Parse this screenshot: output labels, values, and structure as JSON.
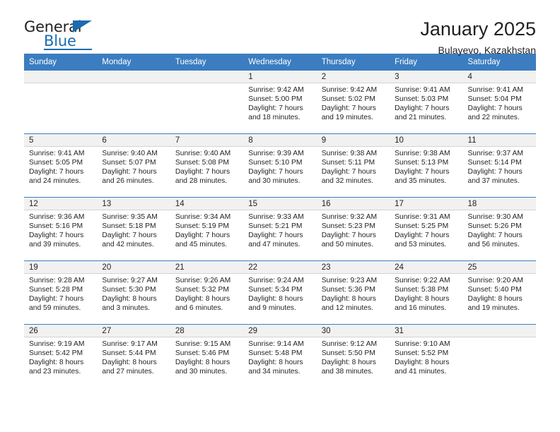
{
  "brand": {
    "name_top": "General",
    "name_bottom": "Blue",
    "accent_color": "#1b6bb0"
  },
  "header": {
    "title": "January 2025",
    "subtitle": "Bulayevo, Kazakhstan"
  },
  "calendar": {
    "header_color": "#3b7dc0",
    "weekday_headers": [
      "Sunday",
      "Monday",
      "Tuesday",
      "Wednesday",
      "Thursday",
      "Friday",
      "Saturday"
    ],
    "weeks": [
      [
        {
          "day": "",
          "sunrise": "",
          "sunset": "",
          "daylight_line1": "",
          "daylight_line2": "",
          "empty": true
        },
        {
          "day": "",
          "sunrise": "",
          "sunset": "",
          "daylight_line1": "",
          "daylight_line2": "",
          "empty": true
        },
        {
          "day": "",
          "sunrise": "",
          "sunset": "",
          "daylight_line1": "",
          "daylight_line2": "",
          "empty": true
        },
        {
          "day": "1",
          "sunrise": "Sunrise: 9:42 AM",
          "sunset": "Sunset: 5:00 PM",
          "daylight_line1": "Daylight: 7 hours",
          "daylight_line2": "and 18 minutes."
        },
        {
          "day": "2",
          "sunrise": "Sunrise: 9:42 AM",
          "sunset": "Sunset: 5:02 PM",
          "daylight_line1": "Daylight: 7 hours",
          "daylight_line2": "and 19 minutes."
        },
        {
          "day": "3",
          "sunrise": "Sunrise: 9:41 AM",
          "sunset": "Sunset: 5:03 PM",
          "daylight_line1": "Daylight: 7 hours",
          "daylight_line2": "and 21 minutes."
        },
        {
          "day": "4",
          "sunrise": "Sunrise: 9:41 AM",
          "sunset": "Sunset: 5:04 PM",
          "daylight_line1": "Daylight: 7 hours",
          "daylight_line2": "and 22 minutes."
        }
      ],
      [
        {
          "day": "5",
          "sunrise": "Sunrise: 9:41 AM",
          "sunset": "Sunset: 5:05 PM",
          "daylight_line1": "Daylight: 7 hours",
          "daylight_line2": "and 24 minutes."
        },
        {
          "day": "6",
          "sunrise": "Sunrise: 9:40 AM",
          "sunset": "Sunset: 5:07 PM",
          "daylight_line1": "Daylight: 7 hours",
          "daylight_line2": "and 26 minutes."
        },
        {
          "day": "7",
          "sunrise": "Sunrise: 9:40 AM",
          "sunset": "Sunset: 5:08 PM",
          "daylight_line1": "Daylight: 7 hours",
          "daylight_line2": "and 28 minutes."
        },
        {
          "day": "8",
          "sunrise": "Sunrise: 9:39 AM",
          "sunset": "Sunset: 5:10 PM",
          "daylight_line1": "Daylight: 7 hours",
          "daylight_line2": "and 30 minutes."
        },
        {
          "day": "9",
          "sunrise": "Sunrise: 9:38 AM",
          "sunset": "Sunset: 5:11 PM",
          "daylight_line1": "Daylight: 7 hours",
          "daylight_line2": "and 32 minutes."
        },
        {
          "day": "10",
          "sunrise": "Sunrise: 9:38 AM",
          "sunset": "Sunset: 5:13 PM",
          "daylight_line1": "Daylight: 7 hours",
          "daylight_line2": "and 35 minutes."
        },
        {
          "day": "11",
          "sunrise": "Sunrise: 9:37 AM",
          "sunset": "Sunset: 5:14 PM",
          "daylight_line1": "Daylight: 7 hours",
          "daylight_line2": "and 37 minutes."
        }
      ],
      [
        {
          "day": "12",
          "sunrise": "Sunrise: 9:36 AM",
          "sunset": "Sunset: 5:16 PM",
          "daylight_line1": "Daylight: 7 hours",
          "daylight_line2": "and 39 minutes."
        },
        {
          "day": "13",
          "sunrise": "Sunrise: 9:35 AM",
          "sunset": "Sunset: 5:18 PM",
          "daylight_line1": "Daylight: 7 hours",
          "daylight_line2": "and 42 minutes."
        },
        {
          "day": "14",
          "sunrise": "Sunrise: 9:34 AM",
          "sunset": "Sunset: 5:19 PM",
          "daylight_line1": "Daylight: 7 hours",
          "daylight_line2": "and 45 minutes."
        },
        {
          "day": "15",
          "sunrise": "Sunrise: 9:33 AM",
          "sunset": "Sunset: 5:21 PM",
          "daylight_line1": "Daylight: 7 hours",
          "daylight_line2": "and 47 minutes."
        },
        {
          "day": "16",
          "sunrise": "Sunrise: 9:32 AM",
          "sunset": "Sunset: 5:23 PM",
          "daylight_line1": "Daylight: 7 hours",
          "daylight_line2": "and 50 minutes."
        },
        {
          "day": "17",
          "sunrise": "Sunrise: 9:31 AM",
          "sunset": "Sunset: 5:25 PM",
          "daylight_line1": "Daylight: 7 hours",
          "daylight_line2": "and 53 minutes."
        },
        {
          "day": "18",
          "sunrise": "Sunrise: 9:30 AM",
          "sunset": "Sunset: 5:26 PM",
          "daylight_line1": "Daylight: 7 hours",
          "daylight_line2": "and 56 minutes."
        }
      ],
      [
        {
          "day": "19",
          "sunrise": "Sunrise: 9:28 AM",
          "sunset": "Sunset: 5:28 PM",
          "daylight_line1": "Daylight: 7 hours",
          "daylight_line2": "and 59 minutes."
        },
        {
          "day": "20",
          "sunrise": "Sunrise: 9:27 AM",
          "sunset": "Sunset: 5:30 PM",
          "daylight_line1": "Daylight: 8 hours",
          "daylight_line2": "and 3 minutes."
        },
        {
          "day": "21",
          "sunrise": "Sunrise: 9:26 AM",
          "sunset": "Sunset: 5:32 PM",
          "daylight_line1": "Daylight: 8 hours",
          "daylight_line2": "and 6 minutes."
        },
        {
          "day": "22",
          "sunrise": "Sunrise: 9:24 AM",
          "sunset": "Sunset: 5:34 PM",
          "daylight_line1": "Daylight: 8 hours",
          "daylight_line2": "and 9 minutes."
        },
        {
          "day": "23",
          "sunrise": "Sunrise: 9:23 AM",
          "sunset": "Sunset: 5:36 PM",
          "daylight_line1": "Daylight: 8 hours",
          "daylight_line2": "and 12 minutes."
        },
        {
          "day": "24",
          "sunrise": "Sunrise: 9:22 AM",
          "sunset": "Sunset: 5:38 PM",
          "daylight_line1": "Daylight: 8 hours",
          "daylight_line2": "and 16 minutes."
        },
        {
          "day": "25",
          "sunrise": "Sunrise: 9:20 AM",
          "sunset": "Sunset: 5:40 PM",
          "daylight_line1": "Daylight: 8 hours",
          "daylight_line2": "and 19 minutes."
        }
      ],
      [
        {
          "day": "26",
          "sunrise": "Sunrise: 9:19 AM",
          "sunset": "Sunset: 5:42 PM",
          "daylight_line1": "Daylight: 8 hours",
          "daylight_line2": "and 23 minutes."
        },
        {
          "day": "27",
          "sunrise": "Sunrise: 9:17 AM",
          "sunset": "Sunset: 5:44 PM",
          "daylight_line1": "Daylight: 8 hours",
          "daylight_line2": "and 27 minutes."
        },
        {
          "day": "28",
          "sunrise": "Sunrise: 9:15 AM",
          "sunset": "Sunset: 5:46 PM",
          "daylight_line1": "Daylight: 8 hours",
          "daylight_line2": "and 30 minutes."
        },
        {
          "day": "29",
          "sunrise": "Sunrise: 9:14 AM",
          "sunset": "Sunset: 5:48 PM",
          "daylight_line1": "Daylight: 8 hours",
          "daylight_line2": "and 34 minutes."
        },
        {
          "day": "30",
          "sunrise": "Sunrise: 9:12 AM",
          "sunset": "Sunset: 5:50 PM",
          "daylight_line1": "Daylight: 8 hours",
          "daylight_line2": "and 38 minutes."
        },
        {
          "day": "31",
          "sunrise": "Sunrise: 9:10 AM",
          "sunset": "Sunset: 5:52 PM",
          "daylight_line1": "Daylight: 8 hours",
          "daylight_line2": "and 41 minutes."
        },
        {
          "day": "",
          "sunrise": "",
          "sunset": "",
          "daylight_line1": "",
          "daylight_line2": "",
          "empty": true
        }
      ]
    ]
  }
}
